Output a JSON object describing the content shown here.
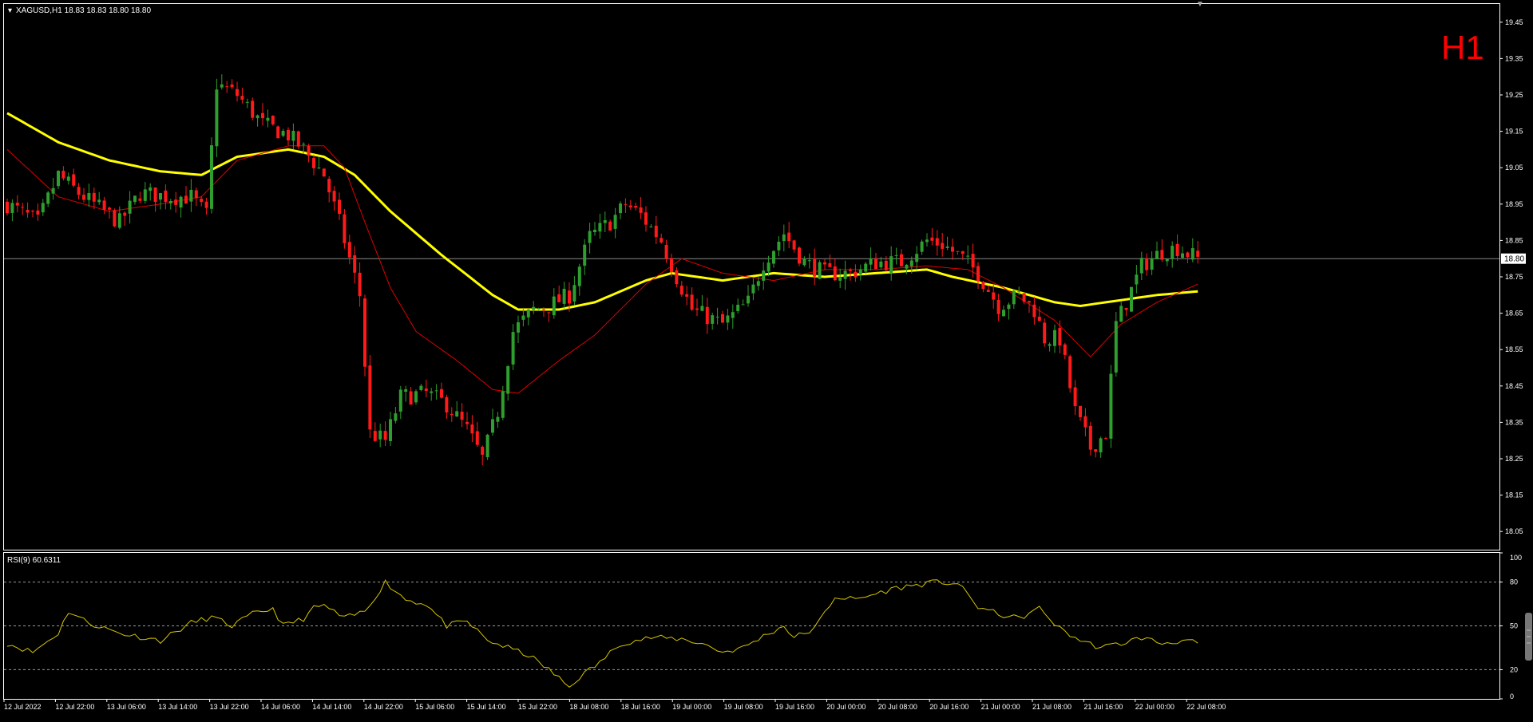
{
  "header": {
    "symbol_line": "XAGUSD,H1  18.83 18.83 18.80 18.80",
    "timeframe_label": "H1",
    "current_price_label": "18.80"
  },
  "colors": {
    "background": "#000000",
    "bull": "#2e9e2e",
    "bear": "#ff1a1a",
    "ma_slow": "#ffff00",
    "ma_fast": "#e00000",
    "rsi": "#d4c600",
    "axis": "#ffffff",
    "timeframe": "#ff0000"
  },
  "chart_data": [
    {
      "type": "candlestick",
      "symbol": "XAGUSD",
      "timeframe": "H1",
      "ylim": [
        18.0,
        19.5
      ],
      "y_ticks": [
        "19.45",
        "19.35",
        "19.25",
        "19.15",
        "19.05",
        "18.95",
        "18.85",
        "18.75",
        "18.65",
        "18.55",
        "18.45",
        "18.35",
        "18.25",
        "18.15",
        "18.05"
      ],
      "current_price": 18.8,
      "x_labels": [
        "12 Jul 2022",
        "12 Jul 22:00",
        "13 Jul 06:00",
        "13 Jul 14:00",
        "13 Jul 22:00",
        "14 Jul 06:00",
        "14 Jul 14:00",
        "14 Jul 22:00",
        "15 Jul 06:00",
        "15 Jul 14:00",
        "15 Jul 22:00",
        "18 Jul 08:00",
        "18 Jul 16:00",
        "19 Jul 00:00",
        "19 Jul 08:00",
        "19 Jul 16:00",
        "20 Jul 00:00",
        "20 Jul 08:00",
        "20 Jul 16:00",
        "21 Jul 00:00",
        "21 Jul 08:00",
        "21 Jul 16:00",
        "22 Jul 00:00",
        "22 Jul 08:00"
      ],
      "ma_slow_key": [
        [
          0,
          19.2
        ],
        [
          10,
          19.12
        ],
        [
          20,
          19.07
        ],
        [
          30,
          19.04
        ],
        [
          38,
          19.03
        ],
        [
          45,
          19.08
        ],
        [
          55,
          19.1
        ],
        [
          62,
          19.08
        ],
        [
          68,
          19.03
        ],
        [
          75,
          18.93
        ],
        [
          85,
          18.81
        ],
        [
          95,
          18.7
        ],
        [
          100,
          18.66
        ],
        [
          108,
          18.66
        ],
        [
          115,
          18.68
        ],
        [
          125,
          18.74
        ],
        [
          130,
          18.76
        ],
        [
          140,
          18.74
        ],
        [
          150,
          18.76
        ],
        [
          160,
          18.75
        ],
        [
          170,
          18.76
        ],
        [
          180,
          18.77
        ],
        [
          185,
          18.75
        ],
        [
          195,
          18.72
        ],
        [
          205,
          18.68
        ],
        [
          210,
          18.67
        ],
        [
          215,
          18.68
        ],
        [
          225,
          18.7
        ],
        [
          233,
          18.71
        ]
      ],
      "ma_fast_key": [
        [
          0,
          19.1
        ],
        [
          10,
          18.97
        ],
        [
          20,
          18.93
        ],
        [
          30,
          18.95
        ],
        [
          38,
          18.97
        ],
        [
          45,
          19.07
        ],
        [
          55,
          19.11
        ],
        [
          62,
          19.11
        ],
        [
          66,
          19.05
        ],
        [
          70,
          18.9
        ],
        [
          75,
          18.72
        ],
        [
          80,
          18.6
        ],
        [
          88,
          18.52
        ],
        [
          95,
          18.44
        ],
        [
          100,
          18.43
        ],
        [
          108,
          18.52
        ],
        [
          115,
          18.59
        ],
        [
          125,
          18.73
        ],
        [
          132,
          18.8
        ],
        [
          140,
          18.76
        ],
        [
          150,
          18.74
        ],
        [
          160,
          18.77
        ],
        [
          170,
          18.77
        ],
        [
          180,
          18.78
        ],
        [
          188,
          18.77
        ],
        [
          195,
          18.72
        ],
        [
          205,
          18.63
        ],
        [
          212,
          18.53
        ],
        [
          218,
          18.62
        ],
        [
          225,
          18.68
        ],
        [
          233,
          18.73
        ]
      ],
      "candle_key": [
        [
          0,
          18.95
        ],
        [
          6,
          18.9
        ],
        [
          10,
          19.03
        ],
        [
          14,
          18.98
        ],
        [
          22,
          18.9
        ],
        [
          26,
          18.98
        ],
        [
          32,
          18.97
        ],
        [
          36,
          18.97
        ],
        [
          39,
          18.92
        ],
        [
          41,
          19.28
        ],
        [
          45,
          19.25
        ],
        [
          50,
          19.17
        ],
        [
          55,
          19.14
        ],
        [
          58,
          19.1
        ],
        [
          62,
          19.03
        ],
        [
          65,
          18.9
        ],
        [
          67,
          18.8
        ],
        [
          69,
          18.7
        ],
        [
          71,
          18.32
        ],
        [
          74,
          18.3
        ],
        [
          77,
          18.42
        ],
        [
          82,
          18.43
        ],
        [
          86,
          18.4
        ],
        [
          90,
          18.33
        ],
        [
          93,
          18.25
        ],
        [
          96,
          18.38
        ],
        [
          99,
          18.6
        ],
        [
          103,
          18.66
        ],
        [
          106,
          18.67
        ],
        [
          110,
          18.7
        ],
        [
          114,
          18.86
        ],
        [
          118,
          18.9
        ],
        [
          121,
          18.95
        ],
        [
          124,
          18.92
        ],
        [
          128,
          18.85
        ],
        [
          131,
          18.75
        ],
        [
          134,
          18.66
        ],
        [
          140,
          18.62
        ],
        [
          145,
          18.68
        ],
        [
          148,
          18.79
        ],
        [
          152,
          18.87
        ],
        [
          156,
          18.79
        ],
        [
          160,
          18.76
        ],
        [
          165,
          18.76
        ],
        [
          170,
          18.79
        ],
        [
          175,
          18.79
        ],
        [
          180,
          18.85
        ],
        [
          183,
          18.84
        ],
        [
          187,
          18.8
        ],
        [
          190,
          18.76
        ],
        [
          194,
          18.67
        ],
        [
          198,
          18.7
        ],
        [
          201,
          18.66
        ],
        [
          203,
          18.58
        ],
        [
          206,
          18.58
        ],
        [
          209,
          18.38
        ],
        [
          212,
          18.28
        ],
        [
          215,
          18.32
        ],
        [
          217,
          18.62
        ],
        [
          219,
          18.68
        ],
        [
          222,
          18.78
        ],
        [
          226,
          18.82
        ],
        [
          229,
          18.83
        ],
        [
          233,
          18.8
        ]
      ],
      "series_count": 234
    },
    {
      "type": "line",
      "title": "RSI(9) 60.6311",
      "ylim": [
        0,
        100
      ],
      "y_ticks": [
        "100",
        "80",
        "50",
        "20",
        "0"
      ],
      "levels": [
        80,
        50,
        20
      ],
      "key": [
        [
          0,
          38
        ],
        [
          5,
          32
        ],
        [
          10,
          45
        ],
        [
          12,
          60
        ],
        [
          16,
          52
        ],
        [
          22,
          45
        ],
        [
          30,
          40
        ],
        [
          36,
          52
        ],
        [
          40,
          56
        ],
        [
          44,
          50
        ],
        [
          48,
          58
        ],
        [
          52,
          62
        ],
        [
          54,
          50
        ],
        [
          58,
          55
        ],
        [
          60,
          62
        ],
        [
          62,
          64
        ],
        [
          66,
          55
        ],
        [
          70,
          60
        ],
        [
          74,
          80
        ],
        [
          78,
          68
        ],
        [
          82,
          65
        ],
        [
          86,
          50
        ],
        [
          90,
          53
        ],
        [
          94,
          40
        ],
        [
          98,
          35
        ],
        [
          102,
          30
        ],
        [
          106,
          20
        ],
        [
          110,
          8
        ],
        [
          112,
          15
        ],
        [
          116,
          25
        ],
        [
          120,
          38
        ],
        [
          126,
          42
        ],
        [
          132,
          41
        ],
        [
          136,
          38
        ],
        [
          140,
          32
        ],
        [
          144,
          35
        ],
        [
          148,
          43
        ],
        [
          152,
          50
        ],
        [
          154,
          42
        ],
        [
          158,
          48
        ],
        [
          162,
          70
        ],
        [
          166,
          68
        ],
        [
          170,
          72
        ],
        [
          174,
          76
        ],
        [
          178,
          78
        ],
        [
          182,
          80
        ],
        [
          186,
          79
        ],
        [
          190,
          63
        ],
        [
          194,
          58
        ],
        [
          198,
          55
        ],
        [
          202,
          62
        ],
        [
          206,
          48
        ],
        [
          210,
          40
        ],
        [
          214,
          35
        ],
        [
          218,
          38
        ],
        [
          222,
          42
        ],
        [
          226,
          38
        ],
        [
          230,
          40
        ],
        [
          233,
          38
        ]
      ]
    }
  ]
}
